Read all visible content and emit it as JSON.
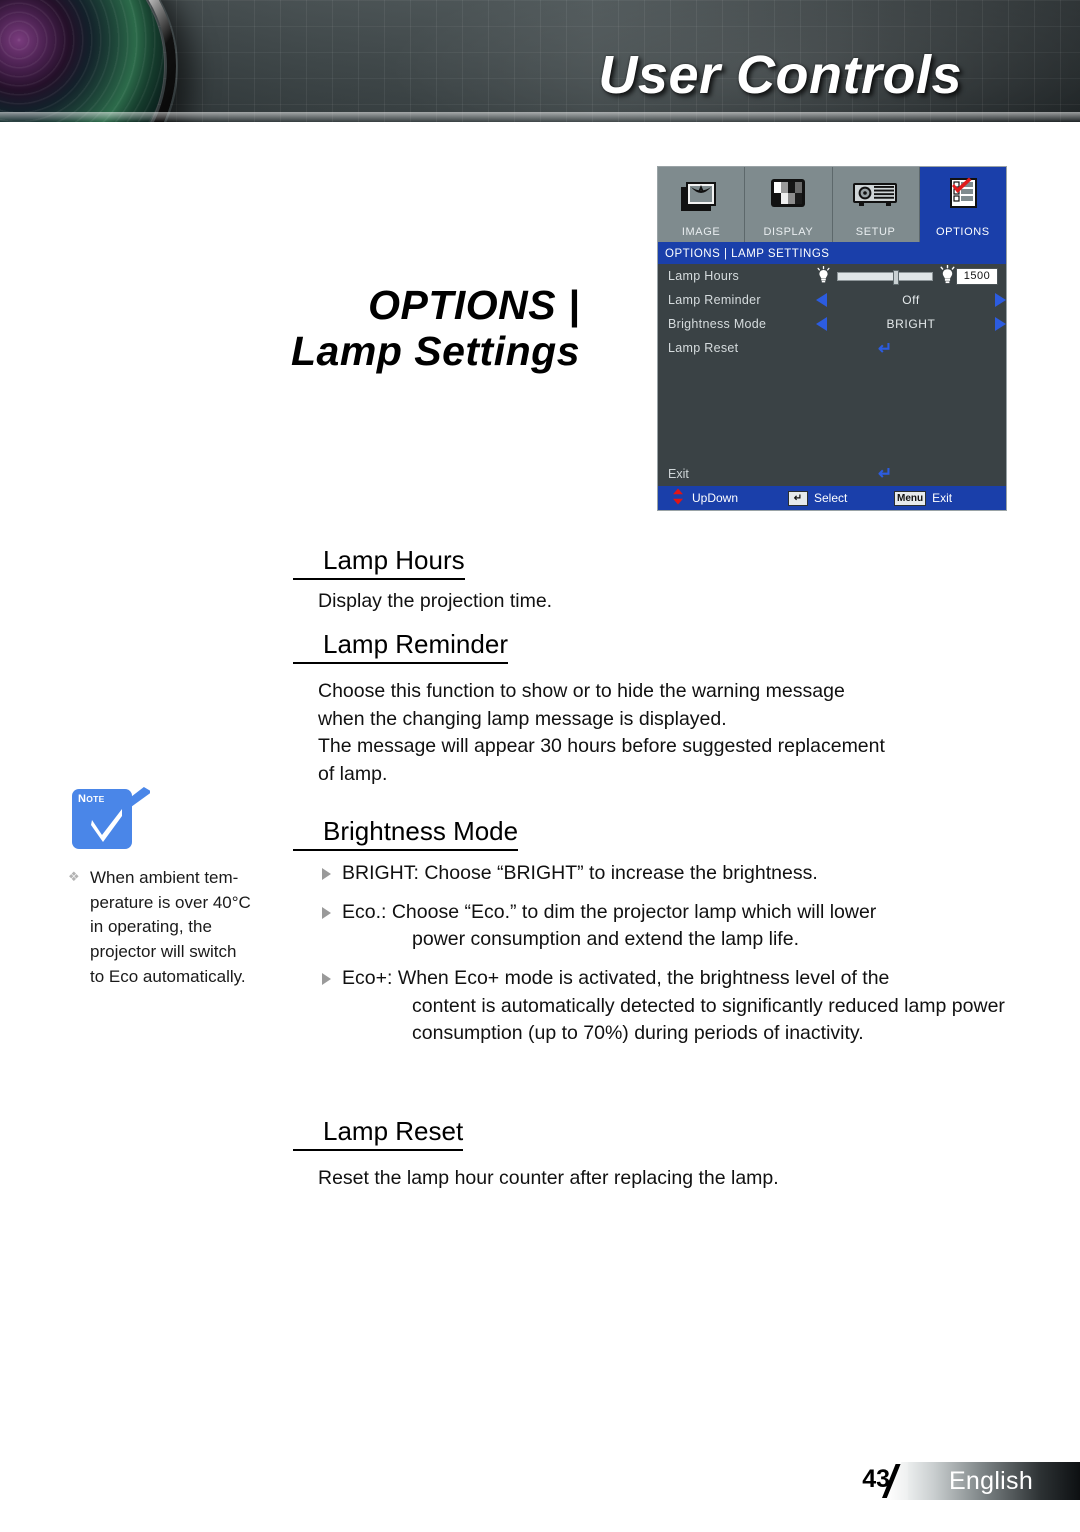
{
  "banner": {
    "title": "User Controls",
    "lens_icon": "camera-lens-graphic"
  },
  "doc_title": {
    "line1": "OPTIONS |",
    "line2": "Lamp Settings"
  },
  "osd": {
    "tabs": [
      {
        "label": "IMAGE",
        "icon": "image-stack-icon",
        "active": false
      },
      {
        "label": "DISPLAY",
        "icon": "display-pattern-icon",
        "active": false
      },
      {
        "label": "SETUP",
        "icon": "projector-icon",
        "active": false
      },
      {
        "label": "OPTIONS",
        "icon": "checklist-icon",
        "active": true
      }
    ],
    "header": "OPTIONS | LAMP SETTINGS",
    "rows": [
      {
        "label": "Lamp Hours",
        "type": "slider",
        "value": "1500",
        "left_icon": "lamp-small-icon",
        "right_icon": "lamp-large-icon"
      },
      {
        "label": "Lamp Reminder",
        "type": "option",
        "value": "Off",
        "left_icon": "arrow-left-icon",
        "right_icon": "arrow-right-icon"
      },
      {
        "label": "Brightness Mode",
        "type": "option",
        "value": "BRIGHT",
        "left_icon": "arrow-left-icon",
        "right_icon": "arrow-right-icon"
      },
      {
        "label": "Lamp Reset",
        "type": "enter",
        "value": "↵",
        "icon": "enter-arrow-icon"
      }
    ],
    "exit_row": {
      "label": "Exit",
      "icon": "enter-arrow-icon",
      "value": "↵"
    },
    "footer": [
      {
        "label": "UpDown",
        "icon": "up-down-arrows-icon",
        "key": ""
      },
      {
        "label": "Select",
        "icon": "enter-key-icon",
        "key": "↵"
      },
      {
        "label": "Exit",
        "icon": "menu-key-icon",
        "key": "Menu"
      }
    ],
    "colors": {
      "accent_blue": "#1a3faa",
      "body_bg": "#3a4245",
      "tab_bg": "#7f8b8e",
      "arrow_blue": "#2c5ce0"
    }
  },
  "sections": [
    {
      "heading": "Lamp Hours",
      "body": "Display the projection time."
    },
    {
      "heading": "Lamp Reminder",
      "body_lines": [
        "Choose this function to show or to hide the warning message",
        "when the changing lamp message is displayed.",
        "The message will appear 30 hours before suggested replacement",
        "of lamp."
      ]
    },
    {
      "heading": "Brightness Mode",
      "bullets": [
        {
          "lead": "BRIGHT: Choose “BRIGHT” to increase the brightness.",
          "cont": ""
        },
        {
          "lead": "Eco.: Choose “Eco.” to dim the projector lamp which will lower",
          "cont": "power consumption and extend the lamp life."
        },
        {
          "lead": "Eco+: When Eco+ mode is activated, the brightness level of the",
          "cont": "content is automatically detected to significantly reduced lamp power consumption (up to 70%) during periods of inactivity."
        }
      ]
    },
    {
      "heading": "Lamp Reset",
      "body": "Reset the lamp hour counter after replacing the lamp."
    }
  ],
  "note": {
    "badge_label": "NOTE",
    "icon": "note-checkmark-icon",
    "bullet": "❖",
    "text": "When ambient tem-perature is over 40°C in operating, the projector will switch to Eco automatically.",
    "lines": [
      "When ambient tem-",
      "perature is over 40°C",
      "in operating, the",
      "projector will switch",
      "to Eco automatically."
    ]
  },
  "footer": {
    "page_number": "43",
    "language": "English"
  }
}
